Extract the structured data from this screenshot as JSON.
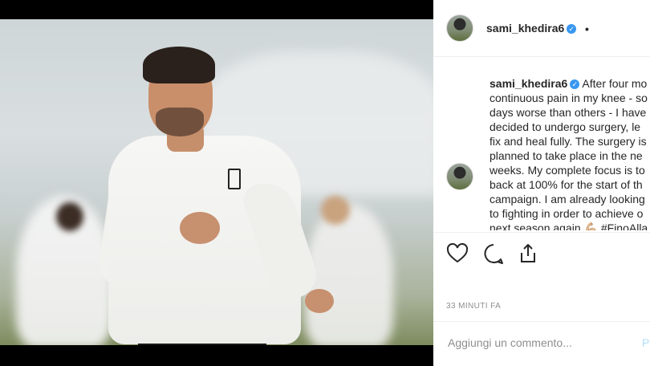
{
  "post": {
    "username": "sami_khedira6",
    "caption_text": "After four months of continuous pain in my knee - some days worse than others - I have decided to undergo surgery, let it fix and heal fully. The surgery is planned to take place in the next weeks. My complete focus is to be back at 100% for the start of the campaign. I am already looking forward to fighting in order to achieve our goals next season again 💪🏼",
    "caption_lines": [
      "After four mo",
      "continuous pain in my knee - so",
      "days worse than others - I have",
      "decided to undergo surgery, le",
      "fix and heal fully. The surgery is",
      "planned to take place in the ne",
      "weeks. My complete focus is to",
      "back at 100% for the start of th",
      "campaign. I am already looking",
      "to fighting in order to achieve o",
      "next season again 💪🏼 #FinoAlla"
    ],
    "timestamp": "33 MINUTI FA",
    "comment_placeholder": "Aggiungi un commento...",
    "publish_label": "P",
    "more_options": "•"
  },
  "icons": {
    "like": "heart-icon",
    "comment": "comment-bubble-icon",
    "share": "share-icon",
    "verified": "verified-badge-icon"
  },
  "colors": {
    "verified": "#3897f0",
    "text": "#262626",
    "muted": "#8e8e8e",
    "publish": "#b2dffc"
  }
}
